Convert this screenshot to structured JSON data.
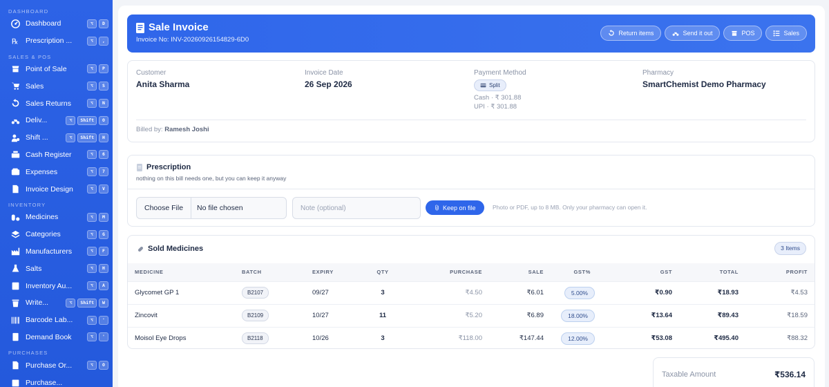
{
  "sidebar": {
    "sections": [
      {
        "label": "DASHBOARD",
        "items": [
          {
            "label": "Dashboard",
            "icon": "dashboard-icon",
            "keys": [
              "⌥",
              "D"
            ]
          },
          {
            "label": "Prescription ...",
            "icon": "prescription-icon",
            "keys": [
              "⌥",
              ","
            ]
          }
        ]
      },
      {
        "label": "SALES & POS",
        "items": [
          {
            "label": "Point of Sale",
            "icon": "pos-icon",
            "keys": [
              "⌥",
              "P"
            ]
          },
          {
            "label": "Sales",
            "icon": "cart-icon",
            "keys": [
              "⌥",
              "S"
            ]
          },
          {
            "label": "Sales Returns",
            "icon": "return-icon",
            "keys": [
              "⌥",
              "N"
            ]
          },
          {
            "label": "Deliv...",
            "icon": "delivery-icon",
            "keys": [
              "⌥",
              "Shift",
              "O"
            ]
          },
          {
            "label": "Shift ...",
            "icon": "shift-icon",
            "keys": [
              "⌥",
              "Shift",
              "H"
            ]
          },
          {
            "label": "Cash Register",
            "icon": "cash-register-icon",
            "keys": [
              "⌥",
              "6"
            ]
          },
          {
            "label": "Expenses",
            "icon": "wallet-icon",
            "keys": [
              "⌥",
              "7"
            ]
          },
          {
            "label": "Invoice Design",
            "icon": "invoice-icon",
            "keys": [
              "⌥",
              "V"
            ]
          }
        ]
      },
      {
        "label": "INVENTORY",
        "items": [
          {
            "label": "Medicines",
            "icon": "pills-icon",
            "keys": [
              "⌥",
              "M"
            ]
          },
          {
            "label": "Categories",
            "icon": "layers-icon",
            "keys": [
              "⌥",
              "G"
            ]
          },
          {
            "label": "Manufacturers",
            "icon": "factory-icon",
            "keys": [
              "⌥",
              "F"
            ]
          },
          {
            "label": "Salts",
            "icon": "flask-icon",
            "keys": [
              "⌥",
              "H"
            ]
          },
          {
            "label": "Inventory Au...",
            "icon": "audit-icon",
            "keys": [
              "⌥",
              "A"
            ]
          },
          {
            "label": "Write...",
            "icon": "trash-icon",
            "keys": [
              "⌥",
              "Shift",
              "W"
            ]
          },
          {
            "label": "Barcode Lab...",
            "icon": "barcode-icon",
            "keys": [
              "⌥",
              "'"
            ]
          },
          {
            "label": "Demand Book",
            "icon": "book-icon",
            "keys": [
              "⌥",
              "'"
            ]
          }
        ]
      },
      {
        "label": "PURCHASES",
        "items": [
          {
            "label": "Purchase Or...",
            "icon": "purchase-order-icon",
            "keys": [
              "⌥",
              "O"
            ]
          },
          {
            "label": "Purchase...",
            "icon": "purchase-icon",
            "keys": []
          }
        ]
      }
    ]
  },
  "header": {
    "title": "Sale Invoice",
    "invoice_no": "Invoice No: INV-20260926154829-6D0",
    "buttons": [
      {
        "label": "Return items",
        "icon": "undo-icon"
      },
      {
        "label": "Send it out",
        "icon": "scooter-icon"
      },
      {
        "label": "POS",
        "icon": "store-icon"
      },
      {
        "label": "Sales",
        "icon": "list-icon"
      }
    ]
  },
  "info": {
    "customer_label": "Customer",
    "customer": "Anita Sharma",
    "date_label": "Invoice Date",
    "date": "26 Sep 2026",
    "payment_label": "Payment Method",
    "payment_method": "Split",
    "cash_line": "Cash · ₹ 301.88",
    "upi_line": "UPI · ₹ 301.88",
    "pharmacy_label": "Pharmacy",
    "pharmacy": "SmartChemist Demo Pharmacy",
    "billed_by_label": "Billed by:",
    "billed_by": "Ramesh Joshi"
  },
  "prescription": {
    "title": "Prescription",
    "subtitle": "nothing on this bill needs one, but you can keep it anyway",
    "choose_file": "Choose File",
    "no_file": "No file chosen",
    "note_placeholder": "Note (optional)",
    "keep_label": "Keep on file",
    "hint": "Photo or PDF, up to 8 MB. Only your pharmacy can open it."
  },
  "sold": {
    "title": "Sold Medicines",
    "count": "3 Items",
    "columns": {
      "medicine": "MEDICINE",
      "batch": "BATCH",
      "expiry": "EXPIRY",
      "qty": "QTY",
      "purchase": "PURCHASE",
      "sale": "SALE",
      "gstp": "GST%",
      "gst": "GST",
      "total": "TOTAL",
      "profit": "PROFIT"
    },
    "rows": [
      {
        "medicine": "Glycomet GP 1",
        "batch": "B2107",
        "expiry": "09/27",
        "qty": "3",
        "purchase": "₹4.50",
        "sale": "₹6.01",
        "gstp": "5.00%",
        "gst": "₹0.90",
        "total": "₹18.93",
        "profit": "₹4.53"
      },
      {
        "medicine": "Zincovit",
        "batch": "B2109",
        "expiry": "10/27",
        "qty": "11",
        "purchase": "₹5.20",
        "sale": "₹6.89",
        "gstp": "18.00%",
        "gst": "₹13.64",
        "total": "₹89.43",
        "profit": "₹18.59"
      },
      {
        "medicine": "Moisol Eye Drops",
        "batch": "B2118",
        "expiry": "10/26",
        "qty": "3",
        "purchase": "₹118.00",
        "sale": "₹147.44",
        "gstp": "12.00%",
        "gst": "₹53.08",
        "total": "₹495.40",
        "profit": "₹88.32"
      }
    ]
  },
  "totals": {
    "taxable_label": "Taxable Amount",
    "taxable_value": "₹536.14"
  },
  "colors": {
    "primary": "#2f66ea",
    "sidebar": "#2459dc",
    "text": "#1e2a44",
    "muted": "#8a93a6"
  }
}
